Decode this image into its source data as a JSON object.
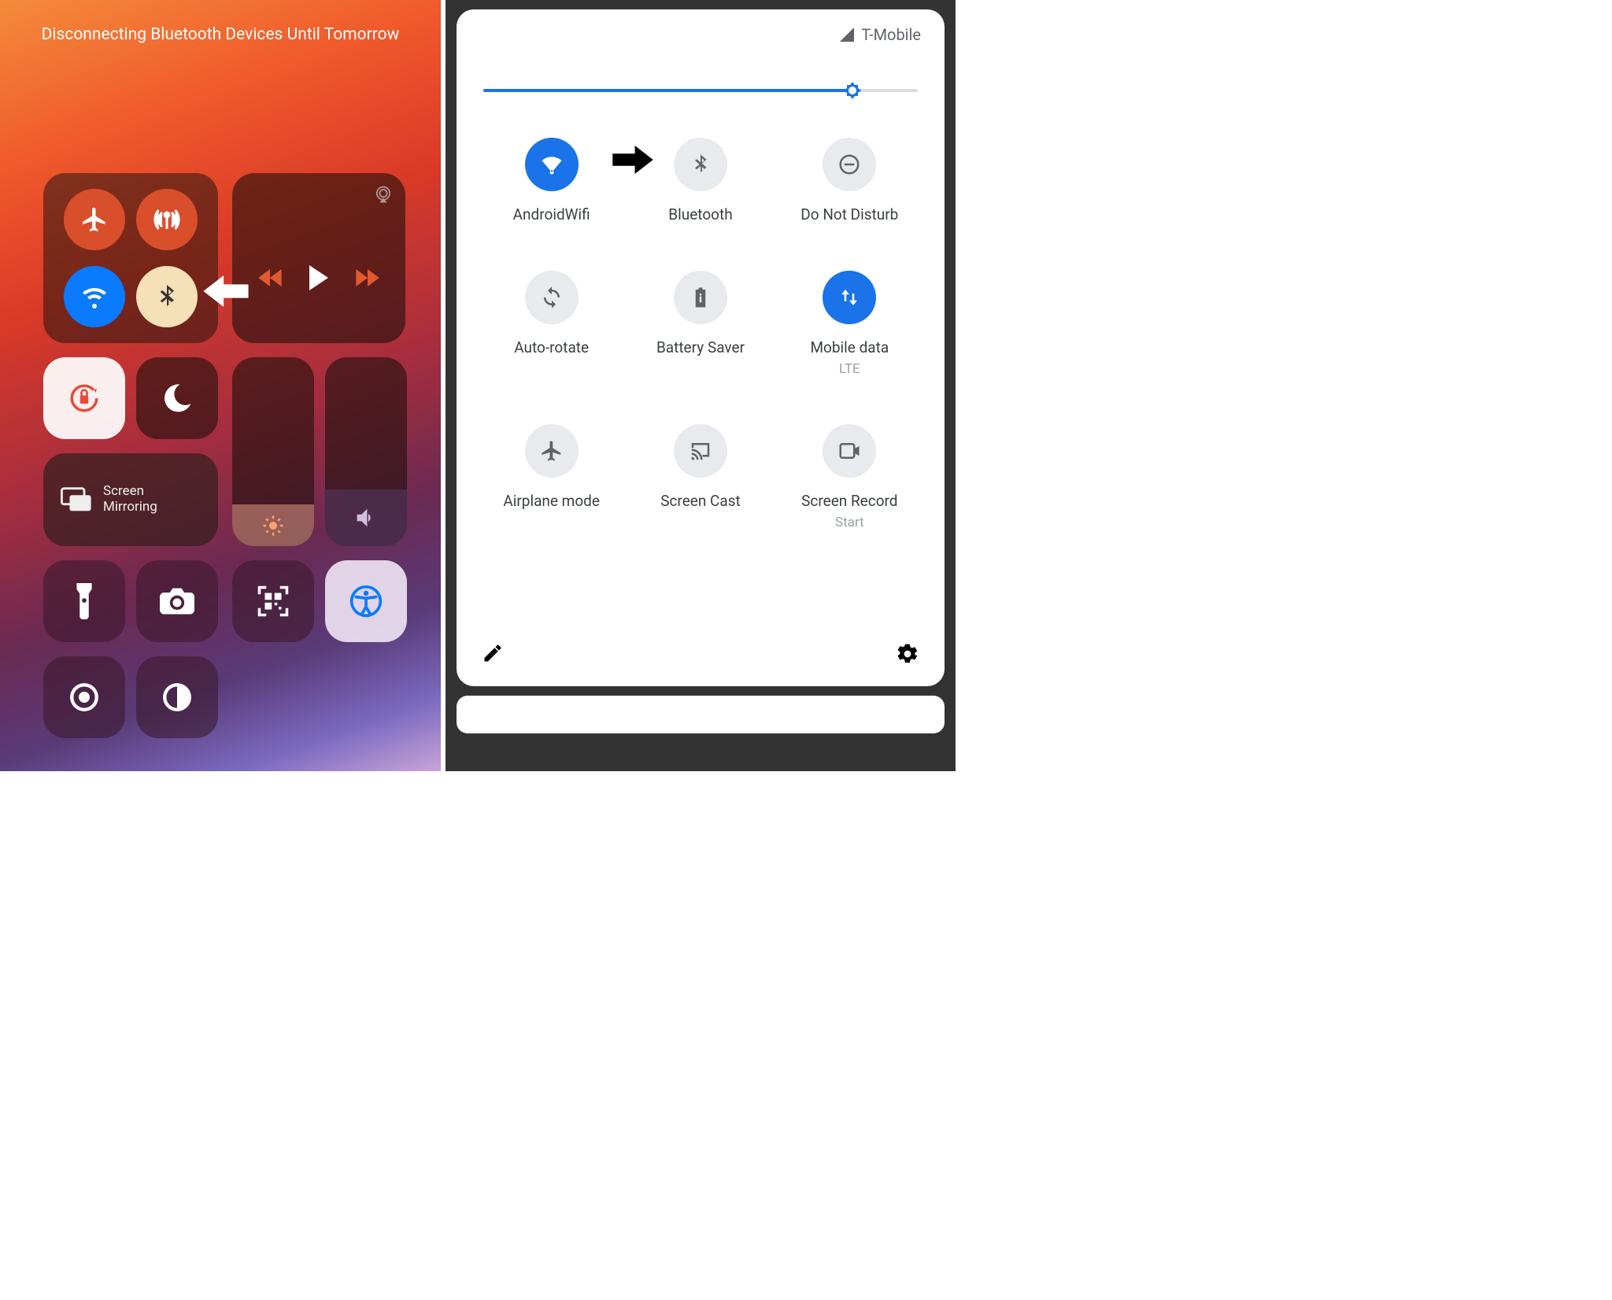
{
  "ios": {
    "toast": "Disconnecting Bluetooth Devices Until Tomorrow",
    "connectivity": {
      "airplane": {
        "on": false
      },
      "cellular": {
        "on": true
      },
      "wifi": {
        "on": true
      },
      "bluetooth": {
        "on": false
      }
    },
    "screen_mirroring_label": "Screen Mirroring",
    "brightness_pct": 22,
    "volume_pct": 30
  },
  "android": {
    "carrier": "T-Mobile",
    "brightness_pct": 84,
    "tiles": [
      {
        "key": "wifi",
        "label": "AndroidWifi",
        "on": true
      },
      {
        "key": "bluetooth",
        "label": "Bluetooth",
        "on": false
      },
      {
        "key": "dnd",
        "label": "Do Not Disturb",
        "on": false
      },
      {
        "key": "autorotate",
        "label": "Auto-rotate",
        "on": false
      },
      {
        "key": "battery",
        "label": "Battery Saver",
        "on": false
      },
      {
        "key": "mobiledata",
        "label": "Mobile data",
        "sub": "LTE",
        "on": true
      },
      {
        "key": "airplane",
        "label": "Airplane mode",
        "on": false
      },
      {
        "key": "cast",
        "label": "Screen Cast",
        "on": false
      },
      {
        "key": "record",
        "label": "Screen Record",
        "sub": "Start",
        "on": false
      }
    ]
  }
}
